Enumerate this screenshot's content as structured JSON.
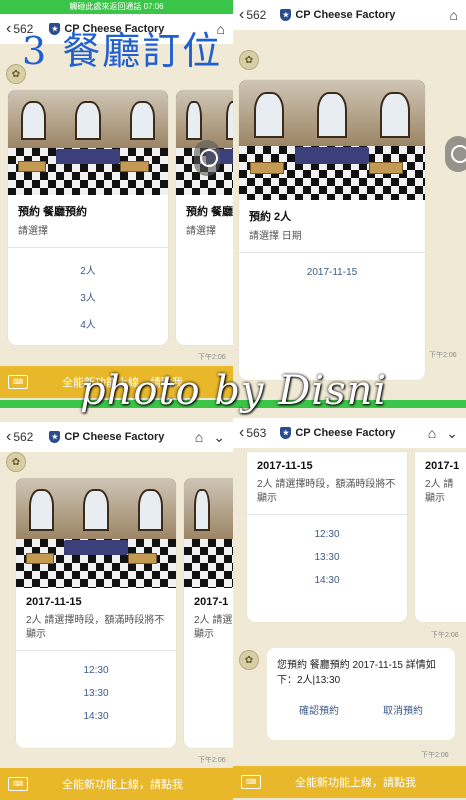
{
  "overlay": {
    "title": "3 餐廳訂位",
    "watermark": "photo by Disni",
    "status_banner": "觸碰此處來返回通話 07:06"
  },
  "panels": {
    "p1": {
      "back_count": "562",
      "title": "CP Cheese Factory",
      "card": {
        "title": "預約 餐廳預約",
        "subtitle": "請選擇",
        "options": [
          "2人",
          "3人",
          "4人"
        ]
      },
      "card2": {
        "title": "預約 餐廳",
        "subtitle": "請選擇"
      },
      "time": "下午2:06",
      "bottom_bar": "全能新功能上線，請點我"
    },
    "p2": {
      "back_count": "562",
      "title": "CP Cheese Factory",
      "card": {
        "title": "預約 2人",
        "subtitle": "請選擇 日期",
        "options": [
          "2017-11-15"
        ]
      },
      "time": "下午2:06"
    },
    "p3": {
      "back_count": "562",
      "title": "CP Cheese Factory",
      "card": {
        "title": "2017-11-15",
        "subtitle": "2人 請選擇時段，額滿時段將不顯示",
        "options": [
          "12:30",
          "13:30",
          "14:30"
        ]
      },
      "card2": {
        "title": "2017-1",
        "subtitle": "2人 請選\n顯示"
      },
      "time": "下午2:06",
      "bottom_bar": "全能新功能上線，請點我"
    },
    "p4": {
      "back_count": "563",
      "title": "CP Cheese Factory",
      "card": {
        "title": "2017-11-15",
        "subtitle": "2人 請選擇時段，額滿時段將不顯示",
        "options": [
          "12:30",
          "13:30",
          "14:30"
        ]
      },
      "card2": {
        "title": "2017-1",
        "subtitle": "2人 請\n顯示"
      },
      "time1": "下午2:06",
      "confirm": {
        "message": "您預約 餐廳預約 2017-11-15 詳情如下：2人|13:30",
        "confirm_label": "確認預約",
        "cancel_label": "取消預約"
      },
      "time2": "下午2:06",
      "bottom_bar": "全能新功能上線，請點我"
    }
  },
  "colors": {
    "accent_blue": "#1f5fd0",
    "line_green": "#3bc548",
    "bar_yellow": "#e8b82a",
    "chat_bg": "#efe9d6"
  }
}
